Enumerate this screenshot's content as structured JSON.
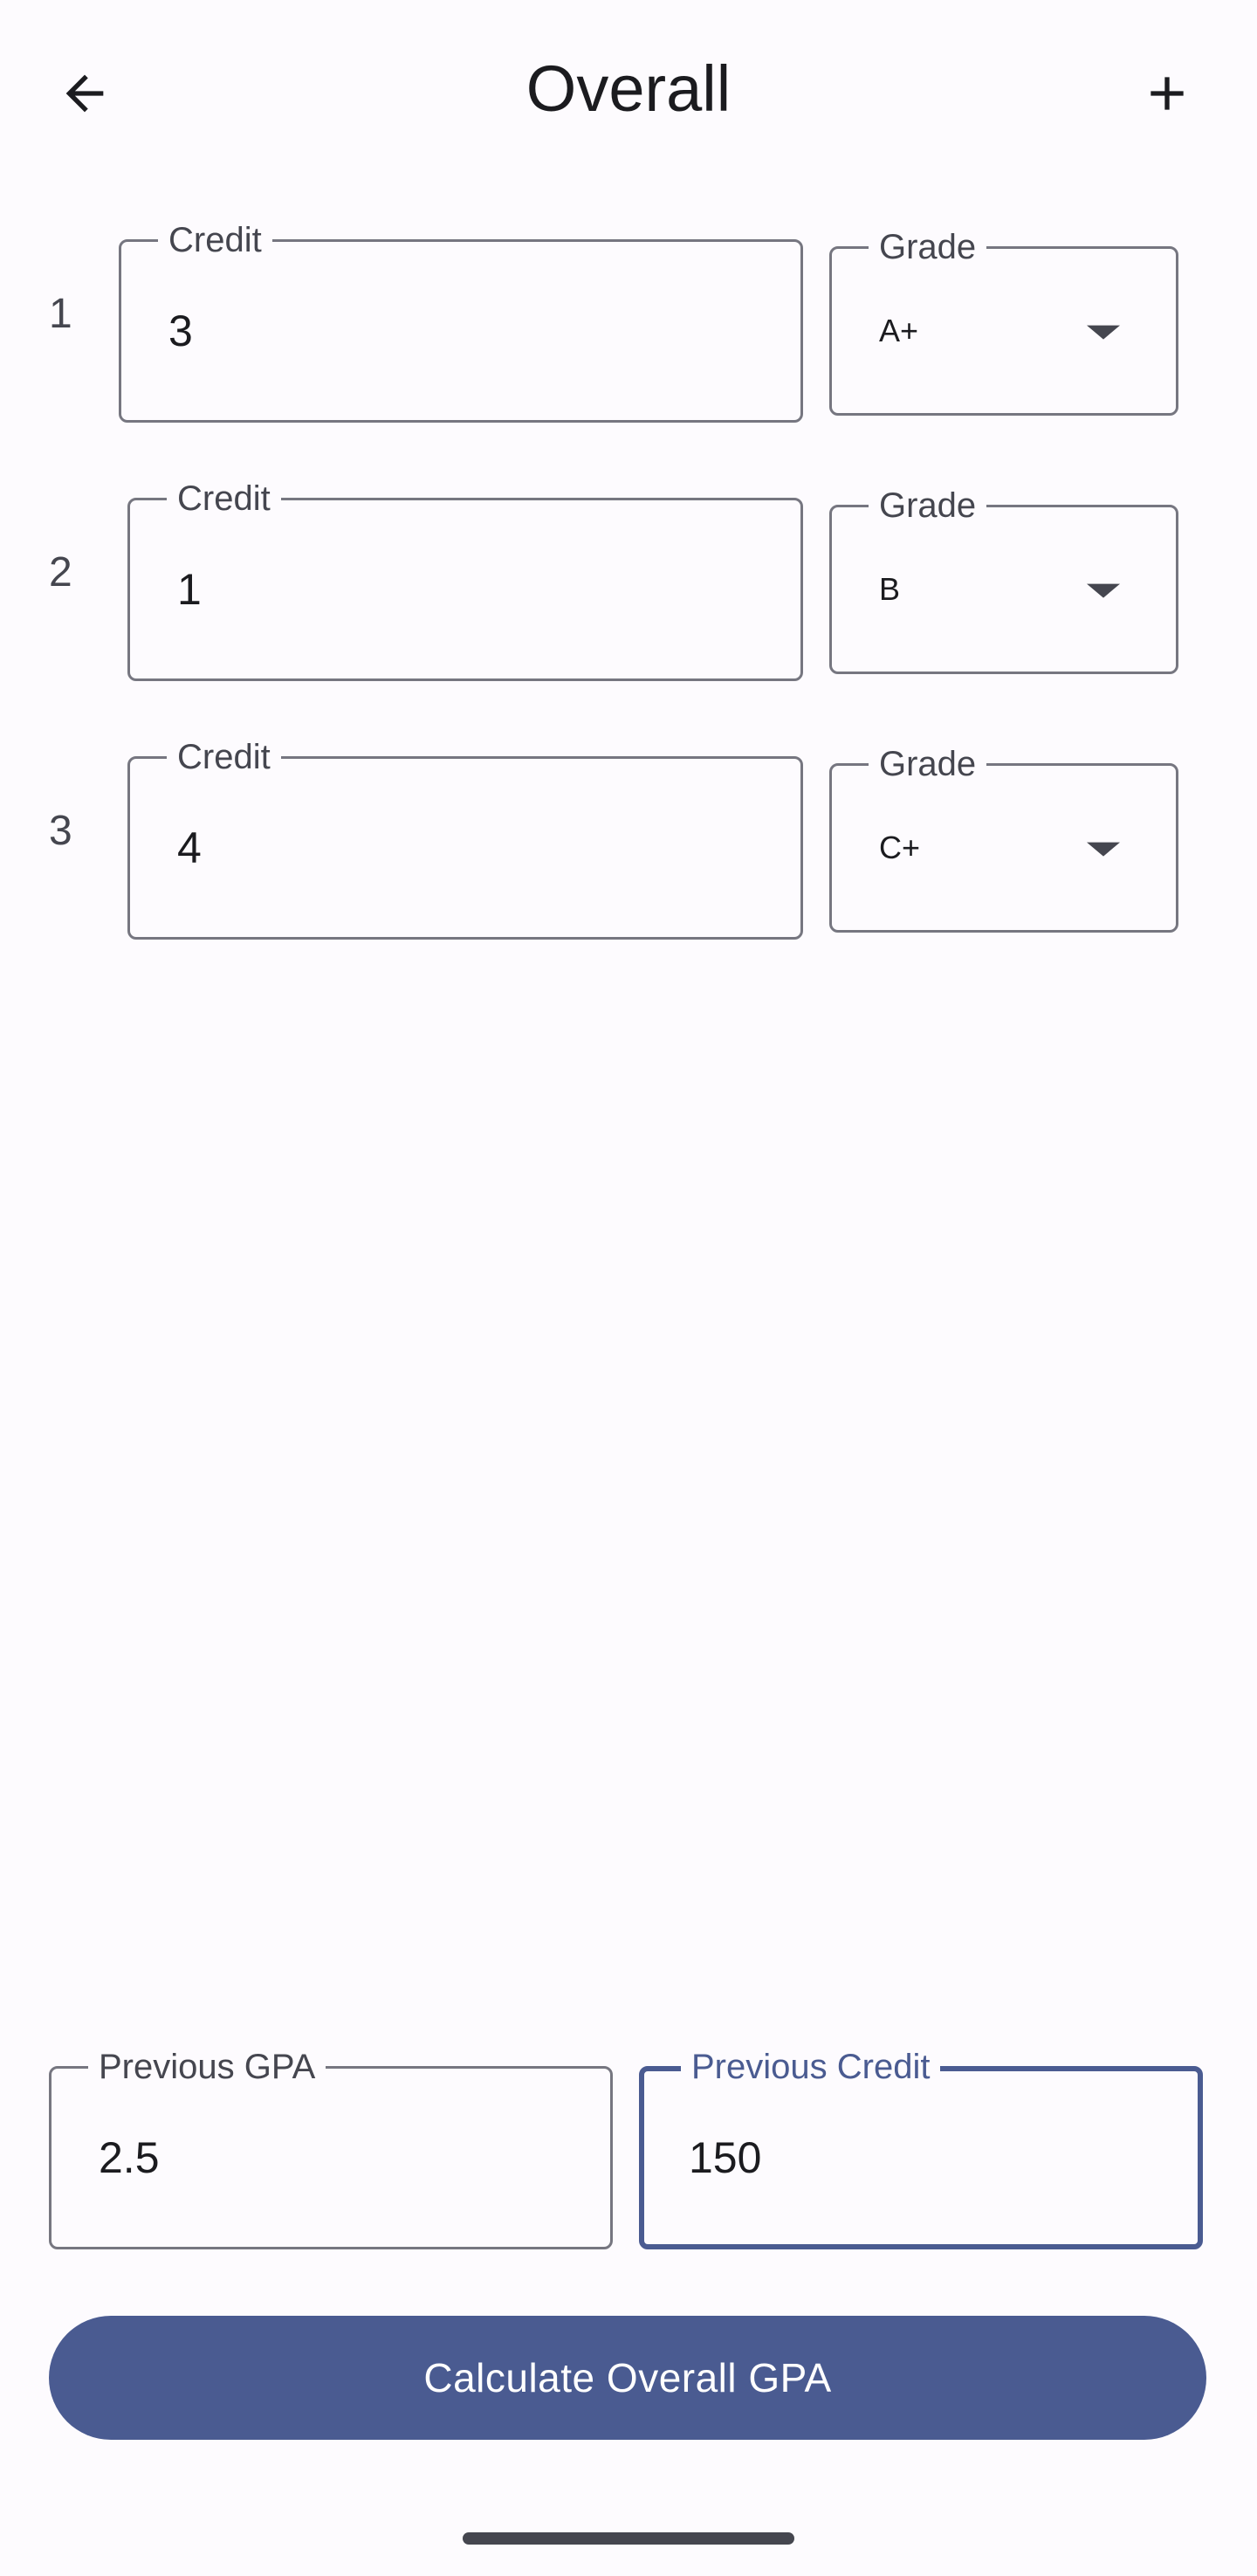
{
  "appbar": {
    "title": "Overall",
    "back_icon": "arrow-back-icon",
    "add_icon": "plus-icon"
  },
  "courses": [
    {
      "index": "1",
      "credit_label": "Credit",
      "credit_value": "3",
      "grade_label": "Grade",
      "grade_value": "A+"
    },
    {
      "index": "2",
      "credit_label": "Credit",
      "credit_value": "1",
      "grade_label": "Grade",
      "grade_value": "B"
    },
    {
      "index": "3",
      "credit_label": "Credit",
      "credit_value": "4",
      "grade_label": "Grade",
      "grade_value": "C+"
    }
  ],
  "previous": {
    "gpa_label": "Previous GPA",
    "gpa_value": "2.5",
    "credit_label": "Previous Credit",
    "credit_value": "150"
  },
  "action": {
    "calculate_label": "Calculate Overall GPA"
  },
  "colors": {
    "background": "#fdfbfe",
    "primary": "#4a5b91",
    "outline": "#767680",
    "on_surface": "#1b1b1f",
    "on_surface_variant": "#45464f"
  }
}
